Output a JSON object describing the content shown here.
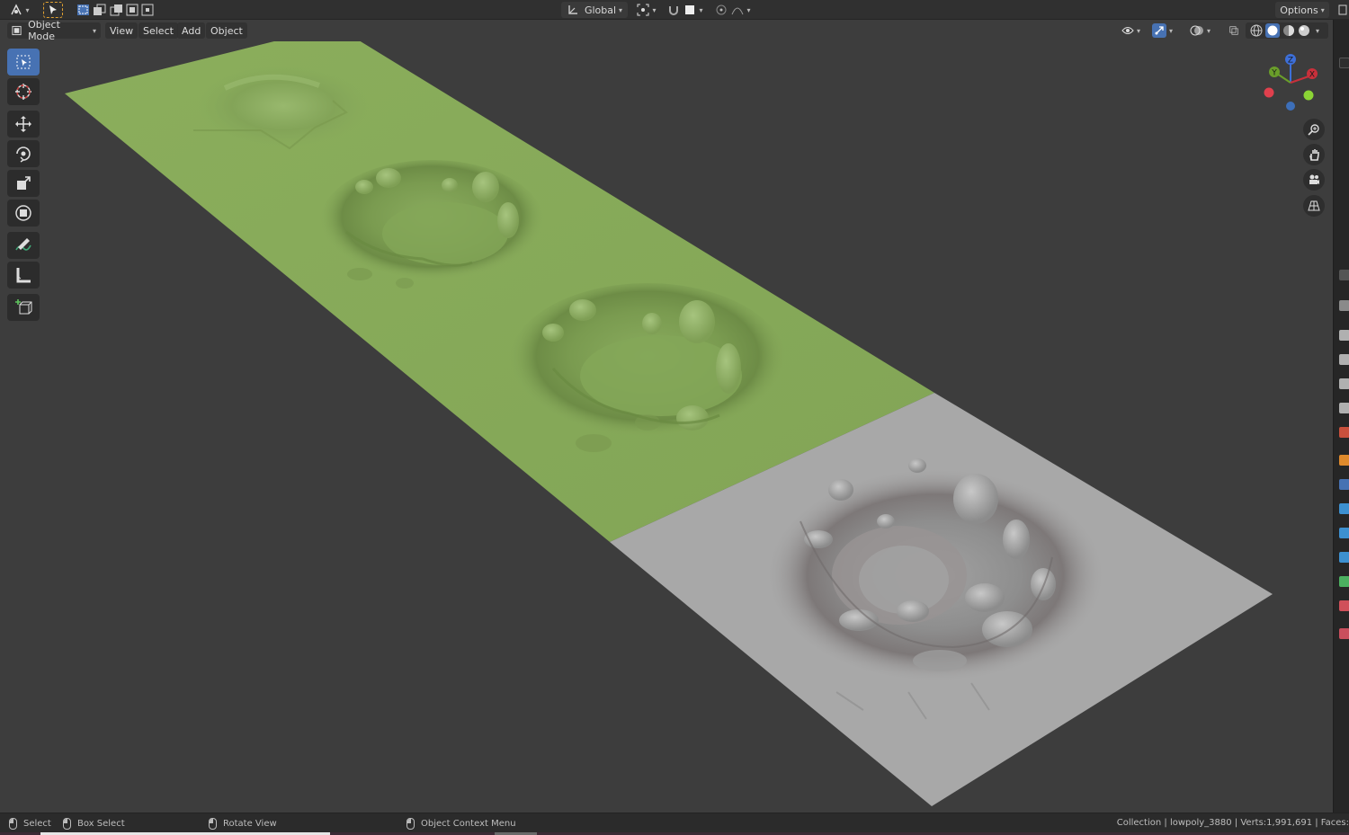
{
  "header": {
    "transform_orientation": "Global",
    "options_label": "Options"
  },
  "viewport_header": {
    "mode": "Object Mode",
    "menus": [
      "View",
      "Select",
      "Add",
      "Object"
    ]
  },
  "toolbar": {
    "tools": [
      "select-box",
      "cursor",
      "move",
      "rotate",
      "scale",
      "transform",
      "annotate",
      "measure",
      "add-cube"
    ],
    "active_tool": "select-box"
  },
  "gizmo": {
    "axes": [
      "Y",
      "Z",
      "X"
    ]
  },
  "statusbar": {
    "select_label": "Select",
    "box_select_label": "Box Select",
    "rotate_view_label": "Rotate View",
    "context_menu_label": "Object Context Menu",
    "stats": "Collection | lowpoly_3880 | Verts:1,991,691 | Faces:"
  },
  "colors": {
    "accent": "#4772b3",
    "background": "#3d3d3d",
    "lowpoly_mesh": "#86a85a",
    "highpoly_mesh": "#a9a9a9"
  }
}
